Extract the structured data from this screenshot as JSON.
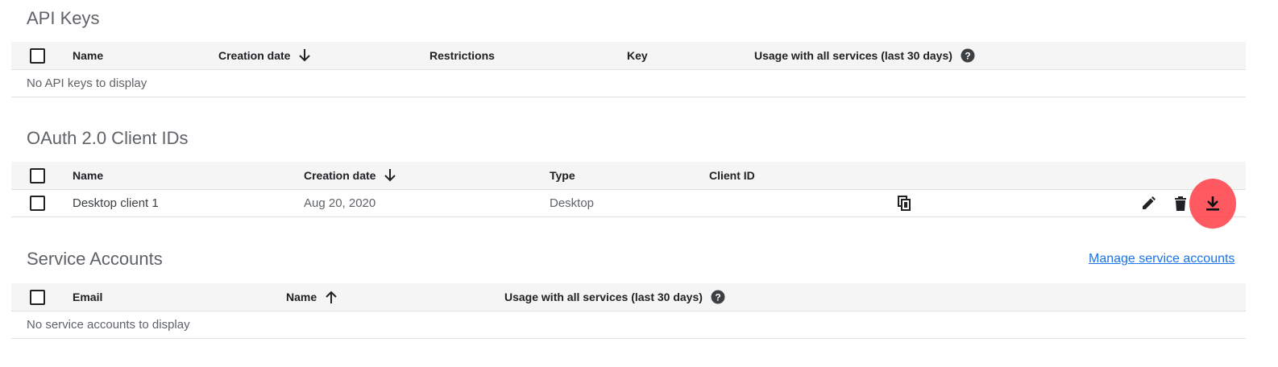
{
  "api_keys": {
    "title": "API Keys",
    "columns": {
      "name": "Name",
      "creation_date": "Creation date",
      "restrictions": "Restrictions",
      "key": "Key",
      "usage": "Usage with all services (last 30 days)"
    },
    "empty_message": "No API keys to display"
  },
  "oauth": {
    "title": "OAuth 2.0 Client IDs",
    "columns": {
      "name": "Name",
      "creation_date": "Creation date",
      "type": "Type",
      "client_id": "Client ID"
    },
    "rows": [
      {
        "name": "Desktop client 1",
        "creation_date": "Aug 20, 2020",
        "type": "Desktop",
        "client_id": ""
      }
    ]
  },
  "service_accounts": {
    "title": "Service Accounts",
    "manage_link": "Manage service accounts",
    "columns": {
      "email": "Email",
      "name": "Name",
      "usage": "Usage with all services (last 30 days)"
    },
    "empty_message": "No service accounts to display"
  },
  "icons": {
    "sort_down": "arrow-down-icon",
    "sort_up": "arrow-up-icon",
    "help": "help-icon",
    "copy": "copy-icon",
    "edit": "pencil-icon",
    "delete": "trash-icon",
    "download": "download-icon"
  },
  "colors": {
    "link": "#1a73e8",
    "header_bg": "#f5f5f5",
    "highlight": "#ff3c46"
  }
}
